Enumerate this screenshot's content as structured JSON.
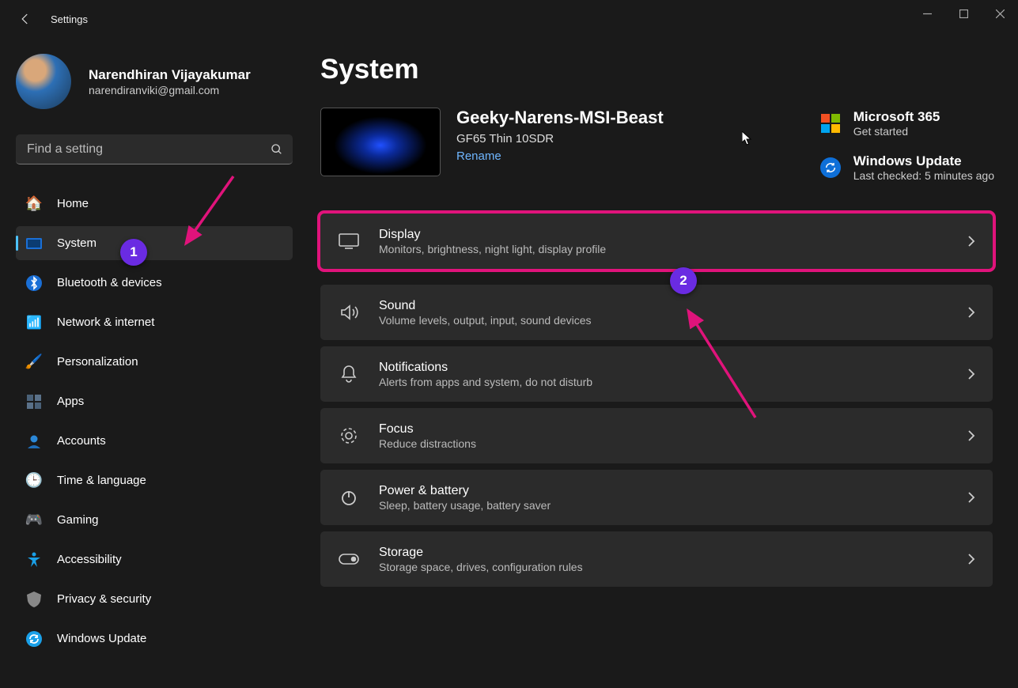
{
  "titlebar": {
    "label": "Settings"
  },
  "profile": {
    "name": "Narendhiran Vijayakumar",
    "email": "narendiranviki@gmail.com"
  },
  "search": {
    "placeholder": "Find a setting"
  },
  "nav": [
    {
      "key": "home",
      "label": "Home",
      "icon": "🏠",
      "selected": false
    },
    {
      "key": "system",
      "label": "System",
      "icon": "🖥️",
      "selected": true
    },
    {
      "key": "bluetooth",
      "label": "Bluetooth & devices",
      "icon": "bt",
      "selected": false
    },
    {
      "key": "network",
      "label": "Network & internet",
      "icon": "📶",
      "selected": false
    },
    {
      "key": "personalization",
      "label": "Personalization",
      "icon": "🖌️",
      "selected": false
    },
    {
      "key": "apps",
      "label": "Apps",
      "icon": "▦",
      "selected": false
    },
    {
      "key": "accounts",
      "label": "Accounts",
      "icon": "👤",
      "selected": false
    },
    {
      "key": "time",
      "label": "Time & language",
      "icon": "🕒",
      "selected": false
    },
    {
      "key": "gaming",
      "label": "Gaming",
      "icon": "🎮",
      "selected": false
    },
    {
      "key": "accessibility",
      "label": "Accessibility",
      "icon": "♿",
      "selected": false
    },
    {
      "key": "privacy",
      "label": "Privacy & security",
      "icon": "🛡️",
      "selected": false
    },
    {
      "key": "update",
      "label": "Windows Update",
      "icon": "🔄",
      "selected": false
    }
  ],
  "main": {
    "title": "System",
    "pc": {
      "name": "Geeky-Narens-MSI-Beast",
      "model": "GF65 Thin 10SDR",
      "rename": "Rename"
    },
    "info": {
      "ms365_title": "Microsoft 365",
      "ms365_sub": "Get started",
      "wu_title": "Windows Update",
      "wu_sub": "Last checked: 5 minutes ago"
    },
    "tiles": [
      {
        "key": "display",
        "title": "Display",
        "sub": "Monitors, brightness, night light, display profile",
        "highlight": true
      },
      {
        "key": "sound",
        "title": "Sound",
        "sub": "Volume levels, output, input, sound devices"
      },
      {
        "key": "notifications",
        "title": "Notifications",
        "sub": "Alerts from apps and system, do not disturb"
      },
      {
        "key": "focus",
        "title": "Focus",
        "sub": "Reduce distractions"
      },
      {
        "key": "power",
        "title": "Power & battery",
        "sub": "Sleep, battery usage, battery saver"
      },
      {
        "key": "storage",
        "title": "Storage",
        "sub": "Storage space, drives, configuration rules"
      }
    ]
  },
  "annotations": {
    "badge1": "1",
    "badge2": "2"
  }
}
